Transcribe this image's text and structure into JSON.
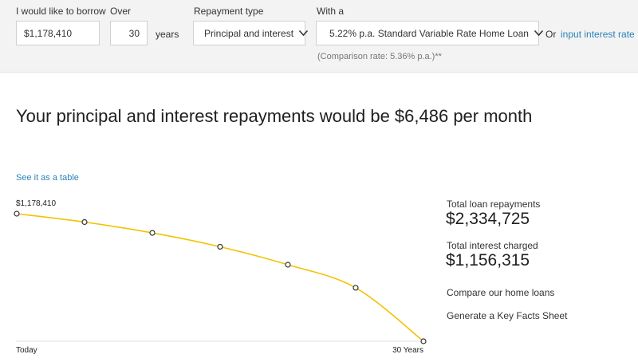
{
  "form": {
    "borrow_label": "I would like to borrow",
    "borrow_value": "$1,178,410",
    "over_label": "Over",
    "term_value": "30",
    "years_label": "years",
    "repayment_label": "Repayment type",
    "repayment_value": "Principal and interest",
    "with_label": "With a",
    "rate_value": "5.22% p.a. Standard Variable Rate Home Loan",
    "or_text": "Or",
    "input_rate_link": "input interest rate",
    "comparison_text": "(Comparison rate: 5.36% p.a.)**"
  },
  "result": {
    "headline": "Your principal and interest repayments would be $6,486 per month",
    "table_link": "See it as a table"
  },
  "chart_data": {
    "type": "line",
    "x": [
      0,
      5,
      10,
      15,
      20,
      25,
      30
    ],
    "y": [
      1178410,
      1101000,
      1001000,
      873000,
      707000,
      494000,
      0
    ],
    "ylim": [
      0,
      1178410
    ],
    "start_label": "$1,178,410",
    "x_start_label": "Today",
    "x_end_label": "30 Years",
    "line_color": "#f2c200",
    "grid": false
  },
  "summary": {
    "total_repay_label": "Total loan repayments",
    "total_repay_value": "$2,334,725",
    "total_interest_label": "Total interest charged",
    "total_interest_value": "$1,156,315",
    "compare_link": "Compare our home loans",
    "kfs_link": "Generate a Key Facts Sheet"
  },
  "colors": {
    "accent": "#2b83b8",
    "line": "#f2c200",
    "panel": "#f3f3f3"
  }
}
